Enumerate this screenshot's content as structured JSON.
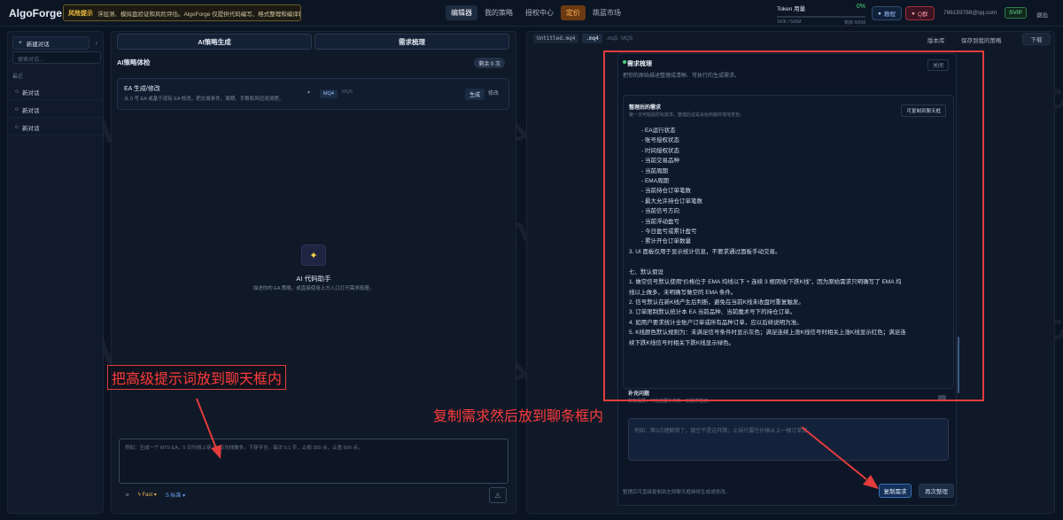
{
  "app": {
    "logo": "AlgoForge",
    "risk_tag": "风险提示",
    "risk_text": "浮层测、模拟盘验证和风险评估。AlgoForge 仅提供代码编写、格式整理和编译辅"
  },
  "nav": [
    {
      "label": "编辑器",
      "active": true
    },
    {
      "label": "我的策略"
    },
    {
      "label": "授权中心"
    },
    {
      "label": "定价",
      "highlight": true
    },
    {
      "label": "跳蓝市场"
    }
  ],
  "token": {
    "label": "Token 用量",
    "percent": "0%",
    "used": "1K/K / 500M",
    "left": "剩余 500M",
    "fill": 0
  },
  "top_buttons": {
    "tutorial": "教程",
    "group": "Q群",
    "email": "7861597​88@qq.com",
    "svip": "SVIP",
    "exit": "退出"
  },
  "sidebar": {
    "new_chat": "新建对话",
    "collapse": "‹",
    "search_placeholder": "搜索对话...",
    "section": "最近",
    "items": [
      "新对话",
      "新对话",
      "新对话"
    ]
  },
  "left": {
    "tabs": [
      "AI策略生成",
      "需求梳理"
    ],
    "check_title": "AI策略体检",
    "remaining": "剩余 0 次",
    "card": {
      "title": "EA 生成/修改",
      "desc": "从 0 写 EA 或基于现有 EA 修改，把交易条件、周期、手数和风控说清楚。",
      "mq4": "MQ4",
      "mq5": "MQ5",
      "gen": "生成",
      "mod": "修改"
    },
    "assistant": {
      "title": "AI 代码助手",
      "desc": "描述你的 EA 策略，或直接使用上方入口打开需求梳理。"
    },
    "input_placeholder": "例如：生成一个 MT5 EA，5 日均线上穿 20 日均线做多，下穿平仓，每次 0.1 手，止损 300 点，止盈 600 点。",
    "tools": {
      "fast": "Fast",
      "std": "S 标准"
    }
  },
  "right": {
    "file": "Untitled.mq4",
    "mq4": ".mq4",
    "mq5": ".mq5",
    "mq5b": "MQ5",
    "version": "版本库",
    "save": "保存到我的策略",
    "download": "下载",
    "modal": {
      "title": "需求梳理",
      "close": "关闭",
      "desc": "把你的原始描述整理成清晰、可执行的生成需求。",
      "inner_title": "整理后的需求",
      "inner_desc": "第一次可粘贴原始需求，整理后这是会给到最终落地发包。",
      "copy_to_chat": "可复制到聊天框",
      "lines": [
        {
          "t": "- EA运行状态",
          "b": true
        },
        {
          "t": "- 账号授权状态",
          "b": true
        },
        {
          "t": "- 时间授权状态",
          "b": true
        },
        {
          "t": "- 当前交易品种",
          "b": true
        },
        {
          "t": "- 当前周期",
          "b": true
        },
        {
          "t": "- EMA周期",
          "b": true
        },
        {
          "t": "- 当前持仓订单笔数",
          "b": true
        },
        {
          "t": "- 最大允许持仓订单笔数",
          "b": true
        },
        {
          "t": "- 当前信号方向",
          "b": true
        },
        {
          "t": "- 当前浮动盈亏",
          "b": true
        },
        {
          "t": "- 今日盈亏或累计盈亏",
          "b": true
        },
        {
          "t": "- 累计开仓订单数量",
          "b": true
        },
        {
          "t": "3. UI 面板仅用于显示统计信息，不要求通过面板手动交易。"
        },
        {
          "t": ""
        },
        {
          "t": "七、默认假设"
        },
        {
          "t": "1. 做空信号默认使用“价格位于 EMA 均线以下 + 连续 3 根阴线/下跌K线”，因为原始需求只明确写了 EMA 均"
        },
        {
          "t": "线以上做多，未明确写做空的 EMA 条件。"
        },
        {
          "t": "2. 信号默认在新K线产生后判断，避免在当前K线未收盘时重复触发。"
        },
        {
          "t": "3. 订单限制默认统计本 EA 当前品种、当前魔术号下的持仓订单。"
        },
        {
          "t": "4. 如用户要求统计全账户订单或所有品种订单，应以后续说明为准。"
        },
        {
          "t": "5. K线颜色默认规则为：未满足信号条件时显示灰色；满足连续上涨K线信号时相关上涨K线显示红色；满足连"
        },
        {
          "t": "续下跌K线信号时相关下跌K线显示绿色。"
        }
      ],
      "supp_title": "补充问题",
      "supp_desc": "如有需要，可在这里补充新一轮需求描述。",
      "input_placeholder": "例如：第3点理解错了，做空不是这样算；止损只要在价格从上一根订单算。",
      "foot": "整理后可直接复制到左侧聊天框继续生成或修改。",
      "btn_copy": "复制需求",
      "btn_redo": "再次整理"
    }
  },
  "annotations": {
    "a1": "把高级提示词放到聊天框内",
    "a2": "复制需求然后放到聊条框内"
  },
  "watermark": "EAHub.cn"
}
